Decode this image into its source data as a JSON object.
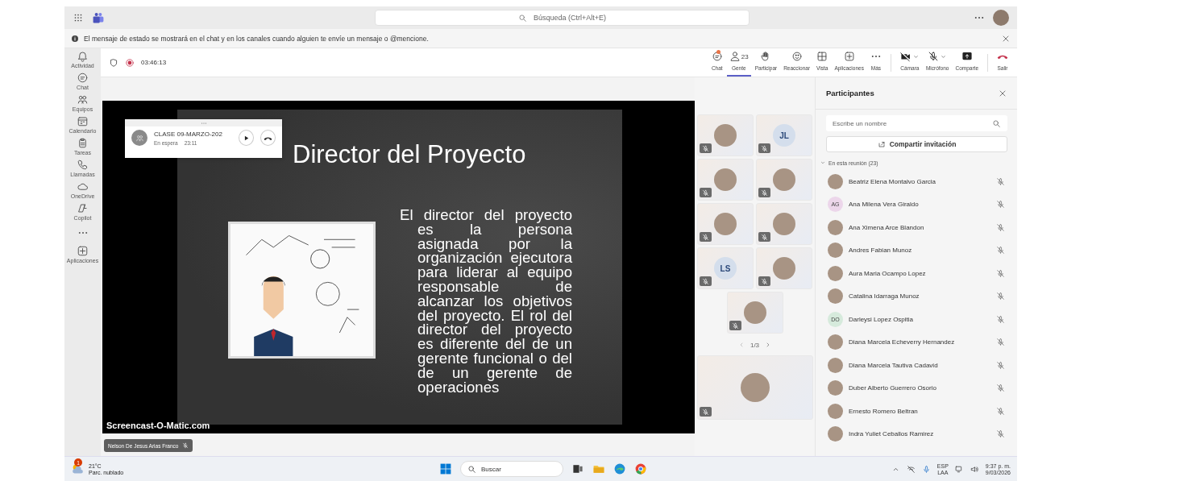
{
  "title_bar": {
    "search": {
      "placeholder": "Búsqueda (Ctrl+Alt+E)"
    }
  },
  "notice": {
    "text": "El mensaje de estado se mostrará en el chat y en los canales cuando alguien te envíe un mensaje o @mencione."
  },
  "rail": [
    {
      "kind": "app",
      "label": "Actividad"
    },
    {
      "kind": "app",
      "label": "Chat"
    },
    {
      "kind": "app",
      "label": "Equipos"
    },
    {
      "kind": "app",
      "label": "Calendario"
    },
    {
      "kind": "app",
      "label": "Tareas"
    },
    {
      "kind": "app",
      "label": "Llamadas"
    },
    {
      "kind": "app",
      "label": "OneDrive"
    },
    {
      "kind": "app",
      "label": "Copilot"
    },
    {
      "kind": "more"
    },
    {
      "kind": "app",
      "label": "Aplicaciones"
    }
  ],
  "meeting": {
    "timer": "03:46:13"
  },
  "toolbar": [
    {
      "kind": "tab",
      "label": "Chat",
      "selected": false,
      "notify": true
    },
    {
      "kind": "tab",
      "label": "Gente",
      "count": "23",
      "selected": true,
      "notify": false
    },
    {
      "kind": "tab",
      "label": "Participar",
      "selected": false,
      "notify": false
    },
    {
      "kind": "tab",
      "label": "Reaccionar",
      "selected": false,
      "notify": false
    },
    {
      "kind": "tab",
      "label": "Vista",
      "selected": false,
      "notify": false
    },
    {
      "kind": "tab",
      "label": "Aplicaciones",
      "selected": false,
      "notify": false
    },
    {
      "kind": "tab",
      "label": "Más",
      "selected": false,
      "notify": false
    },
    {
      "kind": "device",
      "label": "Cámara",
      "selected": false,
      "notify": false
    },
    {
      "kind": "device",
      "label": "Micrófono",
      "selected": false,
      "notify": false
    },
    {
      "kind": "share",
      "label": "Comparte",
      "selected": false,
      "notify": false
    },
    {
      "kind": "leave",
      "label": "Salir",
      "selected": false,
      "notify": false
    }
  ],
  "stage": {
    "slide": {
      "title": "Director del Proyecto",
      "body": "El director del proyecto es la persona asignada por la organización ejecutora para liderar al equipo responsable de alcanzar los objetivos del proyecto. El rol del director del proyecto es diferente del de un gerente funcional o del de un gerente de operaciones"
    },
    "recorder_label": "Screencast-O-Matic.com",
    "presenter": {
      "name": "Nelson De Jesus Arias Franco",
      "muted": true
    }
  },
  "call_card": {
    "title": "CLASE 09-MARZO-202",
    "status": "En espera",
    "time": "23:11"
  },
  "gallery": {
    "tiles": [
      {
        "kind": "photo",
        "muted": true
      },
      {
        "kind": "initials",
        "initials": "JL",
        "muted": true
      },
      {
        "kind": "photo",
        "muted": true
      },
      {
        "kind": "photo",
        "muted": true
      },
      {
        "kind": "photo",
        "muted": true
      },
      {
        "kind": "photo",
        "muted": true
      },
      {
        "kind": "initials",
        "initials": "LS",
        "muted": true
      },
      {
        "kind": "photo",
        "muted": true
      },
      {
        "kind": "photo",
        "muted": true
      }
    ],
    "pager": "1/3",
    "self_tile": {
      "kind": "photo",
      "muted": true
    }
  },
  "participants": {
    "title": "Participantes",
    "search": {
      "placeholder": "Escribe un nombre"
    },
    "invite": "Compartir invitación",
    "section": {
      "label": "En esta reunión (23)",
      "expanded": true
    },
    "people": [
      {
        "name": "Beatriz Elena Montalvo Garcia",
        "kind": "photo",
        "muted": true
      },
      {
        "name": "Ana Milena Vera Giraldo",
        "kind": "initials",
        "initials": "AG",
        "color": "#ecd6ea",
        "muted": true
      },
      {
        "name": "Ana Ximena Arce Blandon",
        "kind": "photo",
        "muted": true
      },
      {
        "name": "Andres Fabian Munoz",
        "kind": "photo",
        "muted": true
      },
      {
        "name": "Aura Maria Ocampo Lopez",
        "kind": "photo",
        "muted": true
      },
      {
        "name": "Catalina Idarraga Munoz",
        "kind": "photo",
        "muted": true
      },
      {
        "name": "Darleysi Lopez Ospitia",
        "kind": "initials",
        "initials": "DO",
        "color": "#d6eadc",
        "muted": true
      },
      {
        "name": "Diana Marcela Echeverry Hernandez",
        "kind": "photo",
        "muted": true
      },
      {
        "name": "Diana Marcela Tautiva Cadavid",
        "kind": "photo",
        "muted": true
      },
      {
        "name": "Duber Alberto Guerrero Osorio",
        "kind": "photo",
        "muted": true
      },
      {
        "name": "Ernesto Romero Beltran",
        "kind": "photo",
        "muted": true
      },
      {
        "name": "Indra Yuliet Ceballos Ramirez",
        "kind": "photo",
        "muted": true
      }
    ]
  },
  "taskbar": {
    "weather": {
      "alerts": "1",
      "temp": "21°C",
      "condition": "Parc. nublado"
    },
    "search": {
      "placeholder": "Buscar"
    },
    "tray": {
      "language": "ESP",
      "layout": "LAA",
      "time": "9:37 p. m.",
      "date": "9/03/2026"
    }
  }
}
